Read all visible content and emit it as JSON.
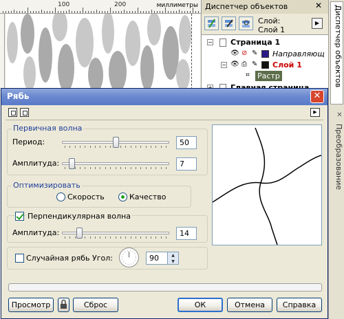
{
  "ruler": {
    "labels": [
      "100",
      "200"
    ],
    "units": "миллиметры"
  },
  "docker": {
    "title": "Диспетчер объектов",
    "layer_line1": "Слой:",
    "layer_line2": "Слой 1",
    "tree": {
      "page1": "Страница 1",
      "guides_layer": "Направляющ",
      "layer1": "Слой 1",
      "raster": "Растр",
      "master_page": "Главная страница"
    },
    "colors": {
      "guides_swatch": "#2a1a88",
      "layer1_swatch": "#111111",
      "layer1_text": "#cc0000"
    }
  },
  "side_tabs": {
    "object_manager": "Диспетчер объектов",
    "transform": "Преобразование"
  },
  "dialog": {
    "title": "Рябь",
    "primary_wave": {
      "title": "Первичная волна",
      "period_label": "Период:",
      "period_value": "50",
      "period_level": 0.5,
      "amplitude_label": "Амплитуда:",
      "amplitude_value": "7",
      "amplitude_level": 0.07
    },
    "optimize": {
      "title": "Оптимизировать",
      "speed_label": "Скорость",
      "quality_label": "Качество",
      "selected": "quality"
    },
    "perpendicular": {
      "checkbox_label": "Перпендикулярная волна",
      "checked": true,
      "amplitude_label": "Амплитуда:",
      "amplitude_value": "14",
      "amplitude_level": 0.14
    },
    "random": {
      "checkbox_label": "Случайная рябь",
      "checked": false,
      "angle_label": "Угол:",
      "angle_value": "90"
    },
    "buttons": {
      "preview": "Просмотр",
      "reset": "Сброс",
      "ok": "ОК",
      "cancel": "Отмена",
      "help": "Справка"
    },
    "colors": {
      "title_bar": "#6c8ad0",
      "close": "#d7452d",
      "group_title": "#1f3e9a"
    }
  }
}
